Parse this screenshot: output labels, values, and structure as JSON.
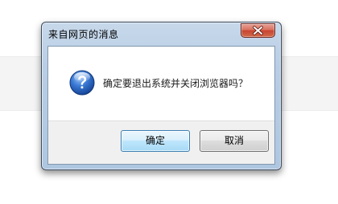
{
  "dialog": {
    "title": "来自网页的消息",
    "message": "确定要退出系统并关闭浏览器吗？",
    "icon": "question-icon",
    "buttons": {
      "ok_label": "确定",
      "cancel_label": "取消"
    }
  },
  "colors": {
    "close_button": "#c74431",
    "ok_button_border": "#3c7fb1",
    "icon_blue": "#1f5fbf"
  }
}
